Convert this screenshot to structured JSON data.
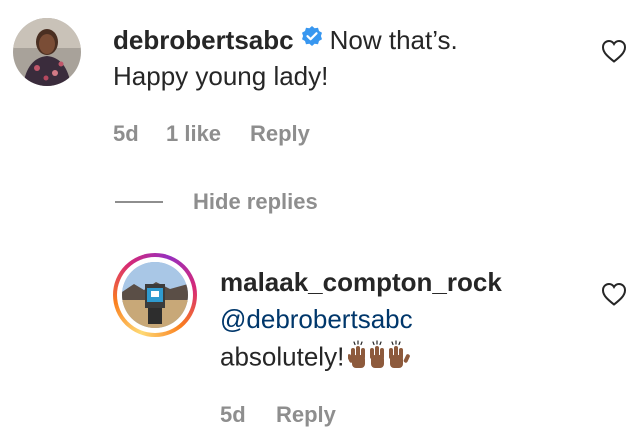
{
  "comment": {
    "username": "debrobertsabc",
    "verified_icon": "verified-badge-icon",
    "text_line1": "Now that’s.",
    "text_line2": "Happy young lady!",
    "time": "5d",
    "likes": "1 like",
    "reply_label": "Reply",
    "like_icon": "heart-outline-icon"
  },
  "replies_toggle": {
    "label": "Hide replies"
  },
  "reply": {
    "username": "malaak_compton_rock",
    "mention": "@debrobertsabc",
    "text": "absolutely!",
    "emoji_icon": "raising-hands-medium-dark-skin-tone",
    "time": "5d",
    "reply_label": "Reply",
    "like_icon": "heart-outline-icon"
  },
  "colors": {
    "text": "#262626",
    "muted": "#8e8e8e",
    "mention": "#00376b",
    "verified": "#3897f0"
  }
}
